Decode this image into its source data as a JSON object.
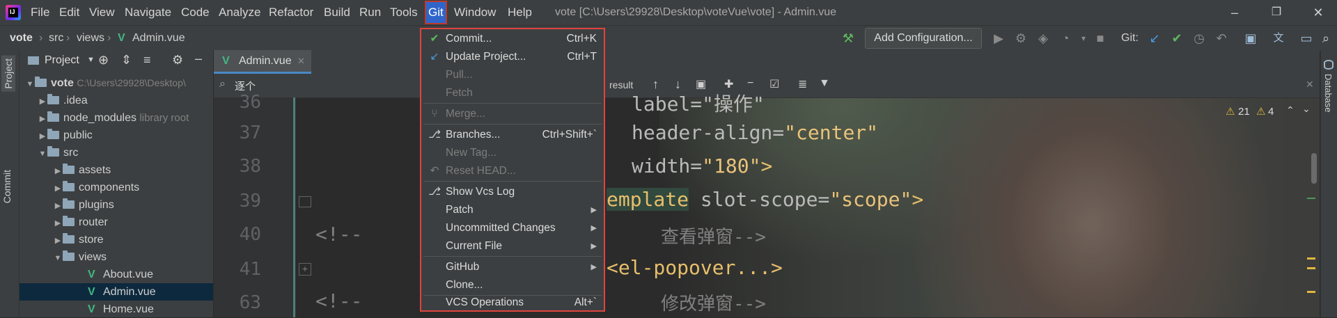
{
  "window": {
    "title": "vote [C:\\Users\\29928\\Desktop\\voteVue\\vote] - Admin.vue"
  },
  "menubar": [
    "File",
    "Edit",
    "View",
    "Navigate",
    "Code",
    "Analyze",
    "Refactor",
    "Build",
    "Run",
    "Tools",
    "Git",
    "Window",
    "Help"
  ],
  "breadcrumb": [
    "vote",
    "src",
    "views",
    "Admin.vue"
  ],
  "toolbar": {
    "add_configuration": "Add Configuration...",
    "git_label": "Git:"
  },
  "sidestrip": {
    "project": "Project",
    "commit": "Commit"
  },
  "rightstrip": {
    "database": "Database"
  },
  "project_panel": {
    "title": "Project",
    "tree": [
      {
        "label": "vote",
        "hint": "C:\\Users\\29928\\Desktop\\",
        "type": "root"
      },
      {
        "label": ".idea",
        "hint": "",
        "type": "folder"
      },
      {
        "label": "node_modules",
        "hint": "library root",
        "type": "folder"
      },
      {
        "label": "public",
        "hint": "",
        "type": "folder"
      },
      {
        "label": "src",
        "hint": "",
        "type": "folder"
      },
      {
        "label": "assets",
        "hint": "",
        "type": "folder"
      },
      {
        "label": "components",
        "hint": "",
        "type": "folder"
      },
      {
        "label": "plugins",
        "hint": "",
        "type": "folder"
      },
      {
        "label": "router",
        "hint": "",
        "type": "folder"
      },
      {
        "label": "store",
        "hint": "",
        "type": "folder"
      },
      {
        "label": "views",
        "hint": "",
        "type": "folder"
      },
      {
        "label": "About.vue",
        "hint": "",
        "type": "vue"
      },
      {
        "label": "Admin.vue",
        "hint": "",
        "type": "vue",
        "selected": true
      },
      {
        "label": "Home.vue",
        "hint": "",
        "type": "vue"
      }
    ]
  },
  "editor": {
    "tab": "Admin.vue",
    "find": {
      "query": "逐个",
      "result": "result"
    },
    "inspections": {
      "warnings": "21",
      "weak_warnings": "4"
    },
    "line_numbers": [
      "36",
      "37",
      "38",
      "39",
      "40",
      "41",
      "63"
    ],
    "lines": [
      {
        "text": "label=\"操作\""
      },
      {
        "attr": "header-align=",
        "str": "\"center\""
      },
      {
        "attr": "width=",
        "str": "\"180\"",
        "rest": ">"
      },
      {
        "tag": "emplate",
        "attr": " slot-scope=",
        "str": "\"scope\"",
        "rest": ">"
      },
      {
        "comment_open": "<!--",
        "comment_text": "查看弹窗-->"
      },
      {
        "tag": "<el-popover...>"
      },
      {
        "comment_open": "<!--",
        "comment_text": "修改弹窗-->"
      }
    ]
  },
  "git_menu": {
    "items": [
      {
        "icon": "check-icon",
        "label": "Commit...",
        "shortcut": "Ctrl+K",
        "enabled": true
      },
      {
        "icon": "update-arrow-icon",
        "label": "Update Project...",
        "shortcut": "Ctrl+T",
        "enabled": true
      },
      {
        "icon": "",
        "label": "Pull...",
        "shortcut": "",
        "enabled": false
      },
      {
        "icon": "",
        "label": "Fetch",
        "shortcut": "",
        "enabled": false
      },
      {
        "icon": "merge-icon",
        "label": "Merge...",
        "shortcut": "",
        "enabled": false
      },
      {
        "icon": "branch-icon",
        "label": "Branches...",
        "shortcut": "Ctrl+Shift+`",
        "enabled": true
      },
      {
        "icon": "",
        "label": "New Tag...",
        "shortcut": "",
        "enabled": false
      },
      {
        "icon": "reset-icon",
        "label": "Reset HEAD...",
        "shortcut": "",
        "enabled": false
      },
      {
        "icon": "vcs-log-icon",
        "label": "Show Vcs Log",
        "shortcut": "",
        "enabled": true
      },
      {
        "icon": "",
        "label": "Patch",
        "shortcut": "",
        "enabled": true,
        "submenu": true
      },
      {
        "icon": "",
        "label": "Uncommitted Changes",
        "shortcut": "",
        "enabled": true,
        "submenu": true
      },
      {
        "icon": "",
        "label": "Current File",
        "shortcut": "",
        "enabled": true,
        "submenu": true
      },
      {
        "icon": "",
        "label": "GitHub",
        "shortcut": "",
        "enabled": true,
        "submenu": true
      },
      {
        "icon": "",
        "label": "Clone...",
        "shortcut": "",
        "enabled": true
      },
      {
        "icon": "",
        "label": "VCS Operations",
        "shortcut": "Alt+`",
        "enabled": true
      }
    ]
  }
}
